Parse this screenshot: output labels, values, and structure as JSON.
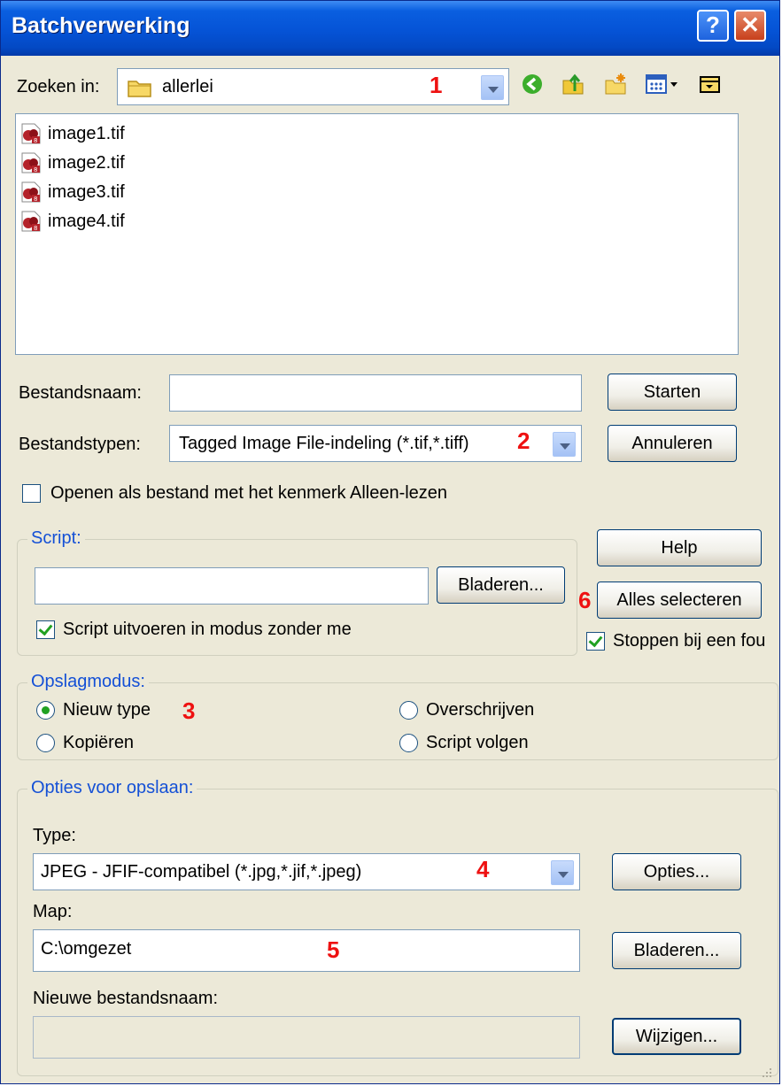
{
  "window": {
    "title": "Batchverwerking"
  },
  "lookin": {
    "label": "Zoeken in:",
    "folder": "allerlei"
  },
  "files": [
    {
      "name": "image1.tif"
    },
    {
      "name": "image2.tif"
    },
    {
      "name": "image3.tif"
    },
    {
      "name": "image4.tif"
    }
  ],
  "filename": {
    "label": "Bestandsnaam:",
    "value": ""
  },
  "filetype": {
    "label": "Bestandstypen:",
    "value": "Tagged Image File-indeling (*.tif,*.tiff)"
  },
  "buttons": {
    "start": "Starten",
    "cancel": "Annuleren",
    "help": "Help",
    "select_all": "Alles selecteren",
    "browse_script": "Bladeren...",
    "options": "Opties...",
    "browse_folder": "Bladeren...",
    "change": "Wijzigen..."
  },
  "readonly_checkbox": {
    "label": "Openen als bestand met het kenmerk Alleen-lezen",
    "checked": false
  },
  "script": {
    "legend": "Script:",
    "value": "",
    "silent_label": "Script uitvoeren in modus zonder me",
    "silent_checked": true
  },
  "stop_on_error": {
    "label": "Stoppen bij een fou",
    "checked": true
  },
  "save_mode": {
    "legend": "Opslagmodus:",
    "options": [
      "Nieuw type",
      "Overschrijven",
      "Kopiëren",
      "Script volgen"
    ],
    "selected": "Nieuw type"
  },
  "save_options": {
    "legend": "Opties voor opslaan:",
    "type_label": "Type:",
    "type_value": "JPEG - JFIF-compatibel (*.jpg,*.jif,*.jpeg)",
    "folder_label": "Map:",
    "folder_value": "C:\\omgezet",
    "new_name_label": "Nieuwe bestandsnaam:",
    "new_name_value": ""
  },
  "annotations": [
    "1",
    "2",
    "3",
    "4",
    "5",
    "6"
  ],
  "colors": {
    "titlebar": "#0553d6",
    "dialog_bg": "#ece9d8",
    "annotation": "#ee1111",
    "group_label": "#1450d6"
  }
}
